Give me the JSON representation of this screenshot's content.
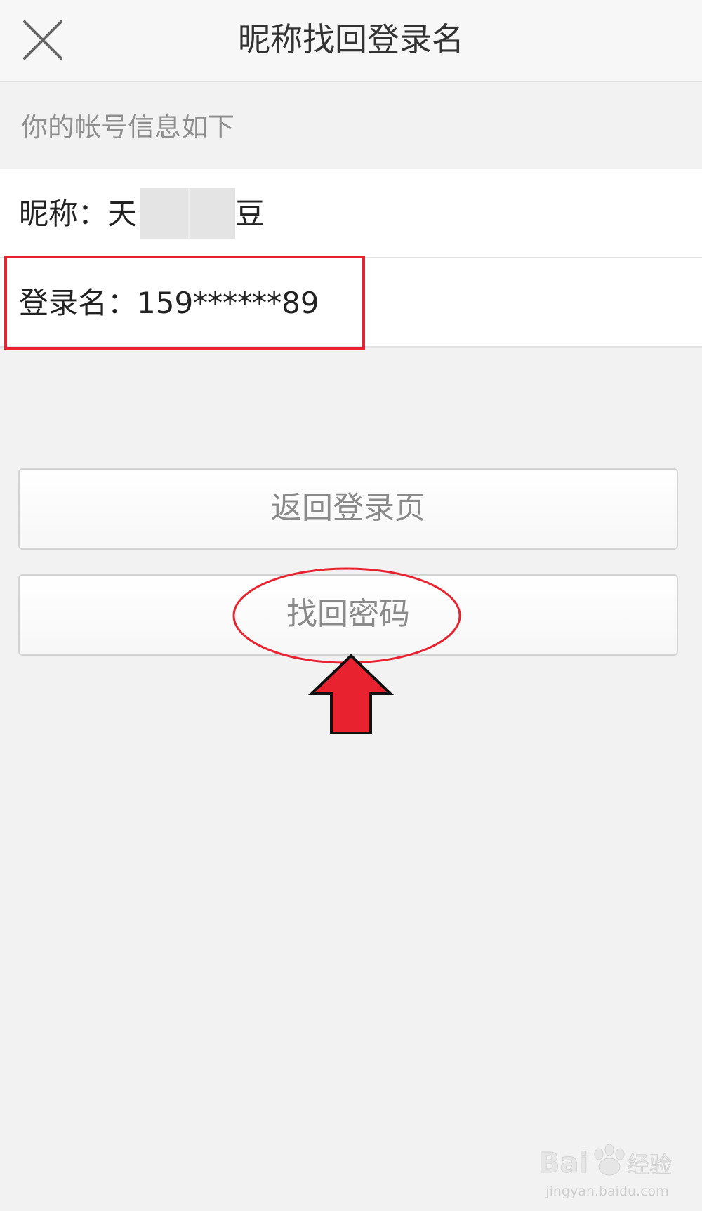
{
  "header": {
    "title": "昵称找回登录名",
    "close_icon": "close-icon"
  },
  "info": {
    "hint": "你的帐号信息如下",
    "nickname_label": "昵称：",
    "nickname_visible_start": "天",
    "nickname_visible_end": "豆",
    "login_label": "登录名：",
    "login_value": "159******89"
  },
  "buttons": {
    "back_to_login": "返回登录页",
    "reset_password": "找回密码"
  },
  "watermark": {
    "brand": "Baidu经验",
    "site": "jingyan.baidu.com"
  },
  "colors": {
    "annotation_red": "#e8232f",
    "background": "#f2f2f2",
    "header_bg": "#f7f7f7",
    "button_text": "#8a8a8a"
  }
}
